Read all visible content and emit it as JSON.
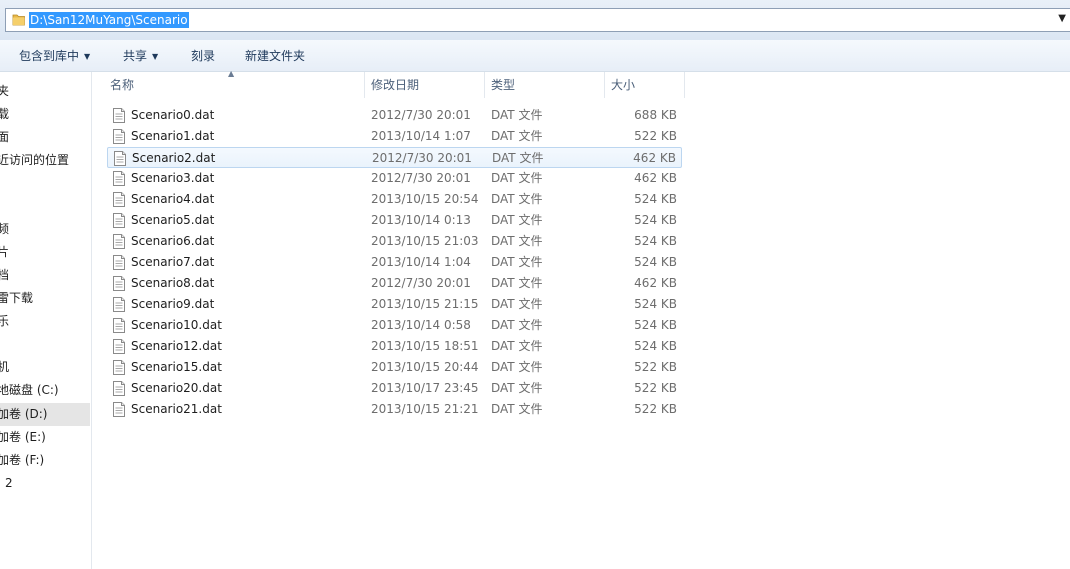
{
  "address": {
    "path": "D:\\San12MuYang\\Scenario"
  },
  "commands": [
    {
      "label": "包含到库中",
      "dropdown": true
    },
    {
      "label": "共享",
      "dropdown": true
    },
    {
      "label": "刻录",
      "dropdown": false
    },
    {
      "label": "新建文件夹",
      "dropdown": false
    }
  ],
  "nav": [
    {
      "label": "夹"
    },
    {
      "label": "载"
    },
    {
      "label": "面"
    },
    {
      "label": "近访问的位置"
    },
    {
      "label": "频"
    },
    {
      "label": "片"
    },
    {
      "label": "档"
    },
    {
      "label": "雷下载"
    },
    {
      "label": "乐"
    },
    {
      "label": "机"
    },
    {
      "label": "地磁盘 (C:)"
    },
    {
      "label": "加卷 (D:)"
    },
    {
      "label": "加卷 (E:)"
    },
    {
      "label": "加卷 (F:)"
    },
    {
      "label": "2"
    }
  ],
  "columns": {
    "name": "名称",
    "date": "修改日期",
    "type": "类型",
    "size": "大小"
  },
  "files": [
    {
      "name": "Scenario0.dat",
      "date": "2012/7/30 20:01",
      "type": "DAT 文件",
      "size": "688 KB"
    },
    {
      "name": "Scenario1.dat",
      "date": "2013/10/14 1:07",
      "type": "DAT 文件",
      "size": "522 KB"
    },
    {
      "name": "Scenario2.dat",
      "date": "2012/7/30 20:01",
      "type": "DAT 文件",
      "size": "462 KB"
    },
    {
      "name": "Scenario3.dat",
      "date": "2012/7/30 20:01",
      "type": "DAT 文件",
      "size": "462 KB"
    },
    {
      "name": "Scenario4.dat",
      "date": "2013/10/15 20:54",
      "type": "DAT 文件",
      "size": "524 KB"
    },
    {
      "name": "Scenario5.dat",
      "date": "2013/10/14 0:13",
      "type": "DAT 文件",
      "size": "524 KB"
    },
    {
      "name": "Scenario6.dat",
      "date": "2013/10/15 21:03",
      "type": "DAT 文件",
      "size": "524 KB"
    },
    {
      "name": "Scenario7.dat",
      "date": "2013/10/14 1:04",
      "type": "DAT 文件",
      "size": "524 KB"
    },
    {
      "name": "Scenario8.dat",
      "date": "2012/7/30 20:01",
      "type": "DAT 文件",
      "size": "462 KB"
    },
    {
      "name": "Scenario9.dat",
      "date": "2013/10/15 21:15",
      "type": "DAT 文件",
      "size": "524 KB"
    },
    {
      "name": "Scenario10.dat",
      "date": "2013/10/14 0:58",
      "type": "DAT 文件",
      "size": "524 KB"
    },
    {
      "name": "Scenario12.dat",
      "date": "2013/10/15 18:51",
      "type": "DAT 文件",
      "size": "524 KB"
    },
    {
      "name": "Scenario15.dat",
      "date": "2013/10/15 20:44",
      "type": "DAT 文件",
      "size": "522 KB"
    },
    {
      "name": "Scenario20.dat",
      "date": "2013/10/17 23:45",
      "type": "DAT 文件",
      "size": "522 KB"
    },
    {
      "name": "Scenario21.dat",
      "date": "2013/10/15 21:21",
      "type": "DAT 文件",
      "size": "522 KB"
    }
  ],
  "hovered_file": "Scenario2.dat",
  "selected_nav": "加卷 (D:)",
  "colors": {
    "selection": "#3399ff",
    "command_text": "#1e395b",
    "header_text": "#4c607a",
    "meta_text": "#6d6d6d"
  },
  "icons": {
    "address": "folder-icon",
    "file": "dat-file-icon",
    "dropdown": "chevron-down-icon"
  }
}
